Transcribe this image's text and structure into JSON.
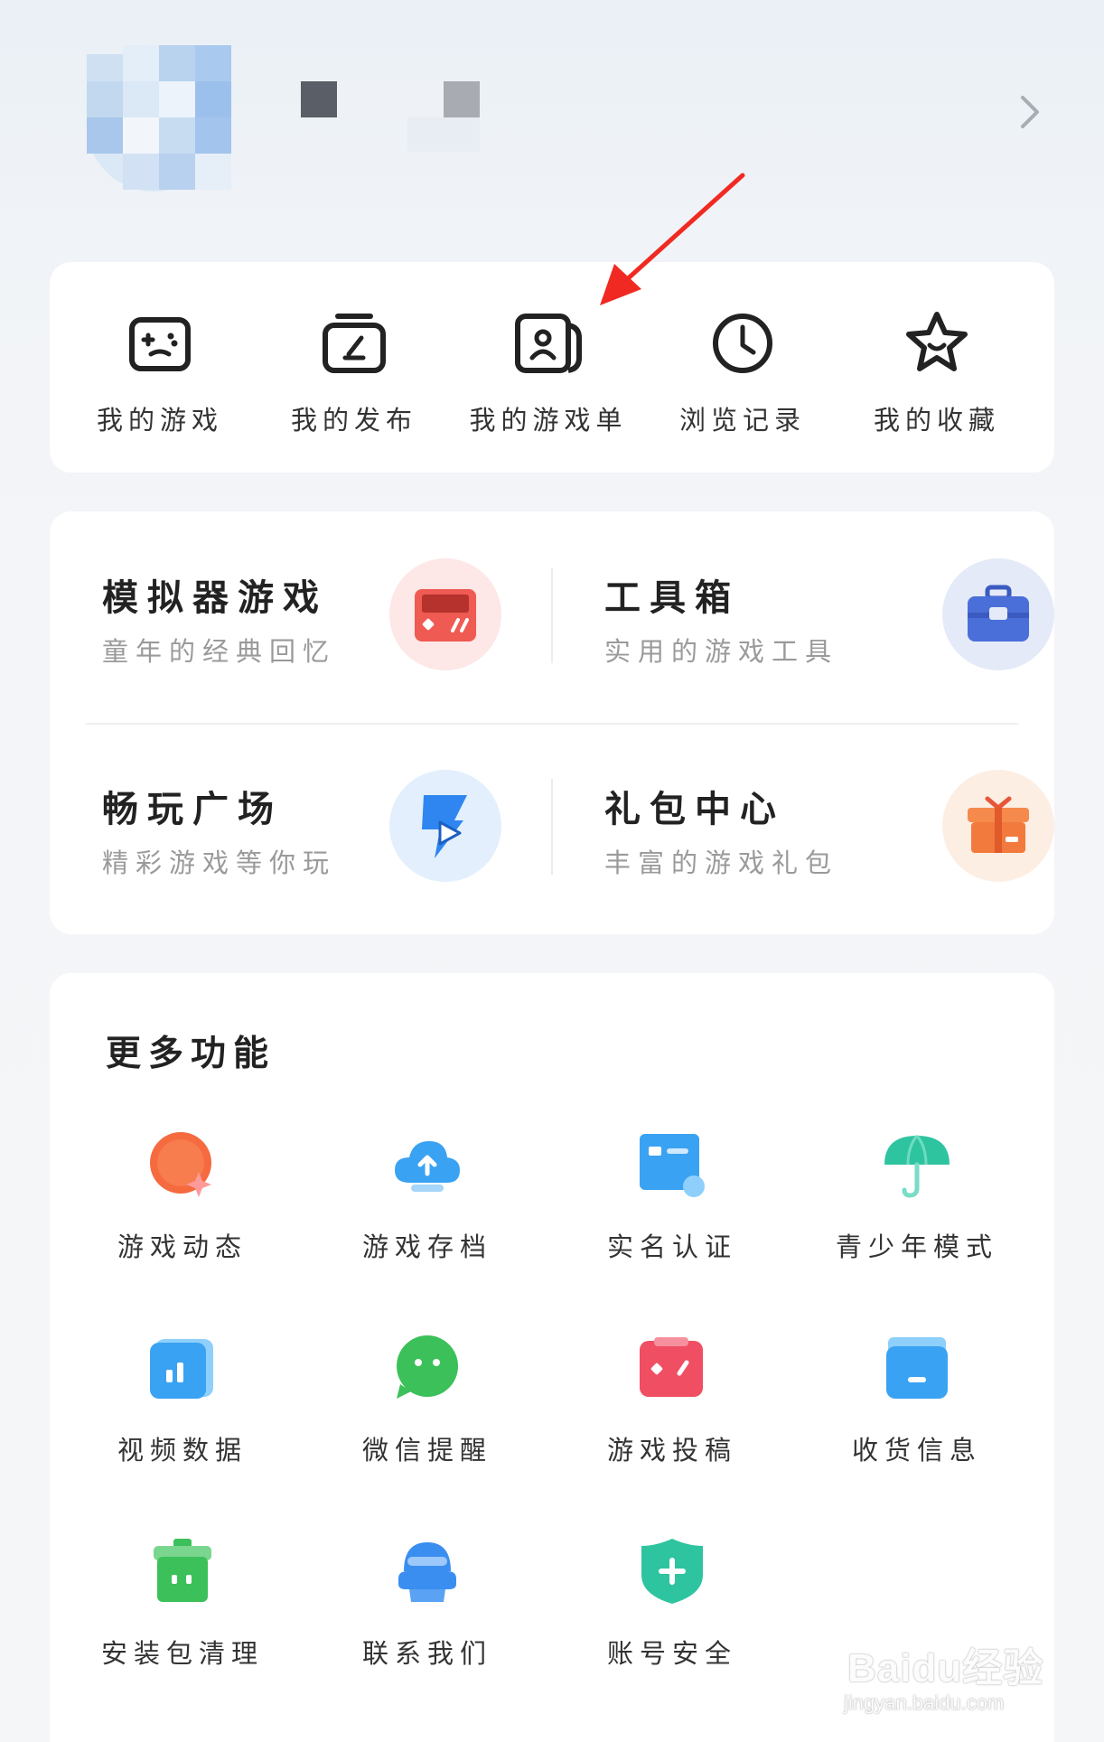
{
  "header": {
    "avatar": "pixelated-avatar",
    "chevron_icon": "chevron-right-icon"
  },
  "quick_actions": [
    {
      "label": "我的游戏",
      "icon": "gamepad-icon"
    },
    {
      "label": "我的发布",
      "icon": "publish-icon"
    },
    {
      "label": "我的游戏单",
      "icon": "game-list-icon"
    },
    {
      "label": "浏览记录",
      "icon": "clock-icon"
    },
    {
      "label": "我的收藏",
      "icon": "star-icon"
    }
  ],
  "features": [
    {
      "title": "模拟器游戏",
      "subtitle": "童年的经典回忆",
      "icon": "emulator-icon",
      "color": "#e8524a"
    },
    {
      "title": "工具箱",
      "subtitle": "实用的游戏工具",
      "icon": "toolbox-icon",
      "color": "#4a6fd8"
    },
    {
      "title": "畅玩广场",
      "subtitle": "精彩游戏等你玩",
      "icon": "play-square-icon",
      "color": "#3a8ef0"
    },
    {
      "title": "礼包中心",
      "subtitle": "丰富的游戏礼包",
      "icon": "gift-icon",
      "color": "#f27a3c"
    }
  ],
  "more": {
    "title": "更多功能",
    "items": [
      {
        "label": "游戏动态",
        "icon": "game-news-icon",
        "color": "#f56a3e"
      },
      {
        "label": "游戏存档",
        "icon": "cloud-upload-icon",
        "color": "#3aa2f2"
      },
      {
        "label": "实名认证",
        "icon": "id-card-icon",
        "color": "#3aa2f2"
      },
      {
        "label": "青少年模式",
        "icon": "umbrella-icon",
        "color": "#2ec4a0"
      },
      {
        "label": "视频数据",
        "icon": "video-chart-icon",
        "color": "#3aa2f2"
      },
      {
        "label": "微信提醒",
        "icon": "wechat-icon",
        "color": "#3cc05a"
      },
      {
        "label": "游戏投稿",
        "icon": "game-submit-icon",
        "color": "#f04e62"
      },
      {
        "label": "收货信息",
        "icon": "shipping-info-icon",
        "color": "#3aa2f2"
      },
      {
        "label": "安装包清理",
        "icon": "trash-icon",
        "color": "#3cc05a"
      },
      {
        "label": "联系我们",
        "icon": "customer-service-icon",
        "color": "#3a8ef0"
      },
      {
        "label": "账号安全",
        "icon": "shield-icon",
        "color": "#2ec4a0"
      }
    ]
  },
  "watermark": {
    "brand": "Baidu经验",
    "url": "jingyan.baidu.com"
  }
}
